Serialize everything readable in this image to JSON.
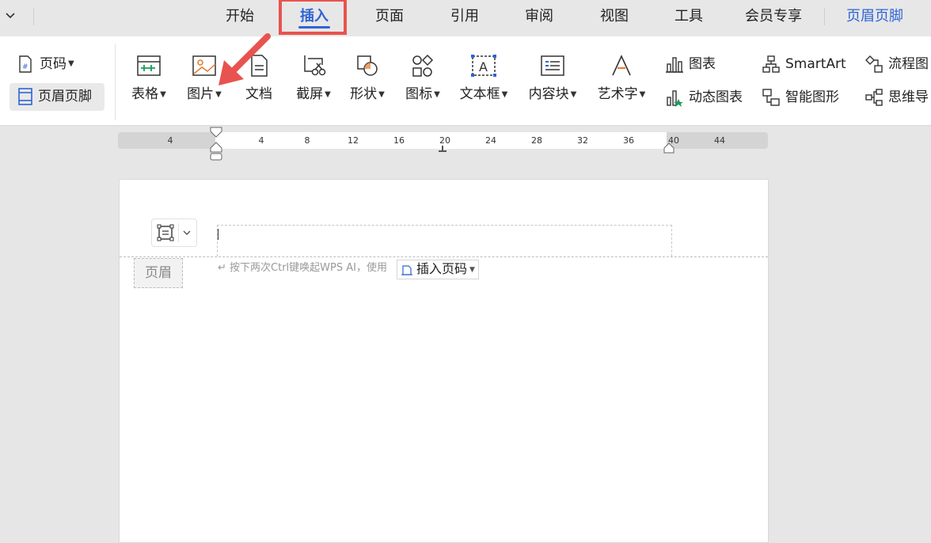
{
  "tabs": [
    "开始",
    "插入",
    "页面",
    "引用",
    "审阅",
    "视图",
    "工具",
    "会员专享",
    "页眉页脚"
  ],
  "ribbon": {
    "page_number": "页码",
    "header_footer": "页眉页脚",
    "table": "表格",
    "picture": "图片",
    "document": "文档",
    "screenshot": "截屏",
    "shape": "形状",
    "icon": "图标",
    "textbox": "文本框",
    "content_block": "内容块",
    "wordart": "艺术字",
    "chart": "图表",
    "dynamic_chart": "动态图表",
    "smartart": "SmartArt",
    "smart_graphic": "智能图形",
    "flowchart": "流程图",
    "mindmap": "思维导"
  },
  "ruler_ticks": [
    "4",
    "4",
    "8",
    "12",
    "16",
    "20",
    "24",
    "28",
    "32",
    "36",
    "40",
    "44"
  ],
  "document": {
    "header_label": "页眉",
    "hint": "按下两次Ctrl键唤起WPS AI，使用",
    "insert_page_number": "插入页码"
  },
  "colors": {
    "accent": "#2f64d6",
    "highlight": "#e8534f"
  }
}
